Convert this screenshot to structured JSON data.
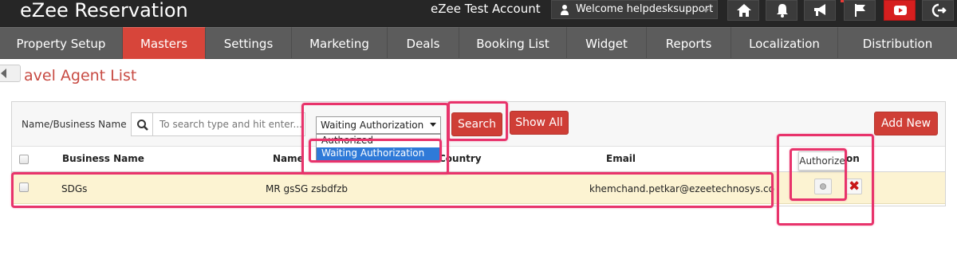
{
  "app": {
    "title": "eZee Reservation",
    "account": "eZee Test Account",
    "welcome": "Welcome helpdesksupport"
  },
  "toolbar_icons": [
    "home-icon",
    "bell-icon",
    "megaphone-icon",
    "flag-icon",
    "youtube-icon",
    "logout-icon"
  ],
  "nav": {
    "items": [
      {
        "label": "Property Setup"
      },
      {
        "label": "Masters"
      },
      {
        "label": "Settings"
      },
      {
        "label": "Marketing"
      },
      {
        "label": "Deals"
      },
      {
        "label": "Booking List"
      },
      {
        "label": "Widget"
      },
      {
        "label": "Reports"
      },
      {
        "label": "Localization"
      },
      {
        "label": "Distribution"
      }
    ],
    "active": "Masters"
  },
  "page": {
    "title": "avel Agent List"
  },
  "filter": {
    "label": "Name/Business Name",
    "search_placeholder": "To search type and hit enter...",
    "status_selected": "Waiting Authorization",
    "status_options": [
      "Authorized",
      "Waiting Authorization"
    ],
    "search_button": "Search",
    "show_all_button": "Show All",
    "add_new_button": "Add New"
  },
  "table": {
    "columns": {
      "business_name": "Business Name",
      "name": "Name",
      "country": "Country",
      "email": "Email",
      "action": "on"
    },
    "rows": [
      {
        "business_name": "SDGs",
        "name": "MR gsSG zsbdfzb",
        "country": "",
        "email": "khemchand.petkar@ezeetechnosys.com"
      }
    ]
  },
  "tooltip": "Authorize",
  "colors": {
    "accent": "#d7453a",
    "highlight": "#e8336b",
    "row_bg": "#fcf3d2",
    "topbar": "#262626",
    "nav": "#5c5c5c"
  }
}
